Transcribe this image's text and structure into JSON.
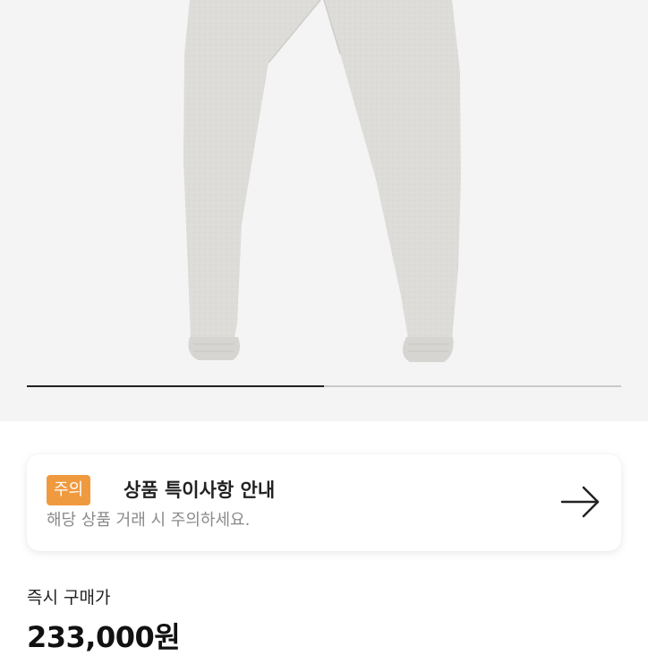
{
  "carousel": {
    "image_alt_icon": "sweatpants-image",
    "progress_fraction": 0.5
  },
  "notice": {
    "badge": "주의",
    "title": "상품 특이사항 안내",
    "subtitle": "해당 상품 거래 시 주의하세요.",
    "action_icon": "arrow-right-icon",
    "badge_color": "#f09a3f"
  },
  "price": {
    "label": "즉시 구매가",
    "value": "233,000원"
  }
}
